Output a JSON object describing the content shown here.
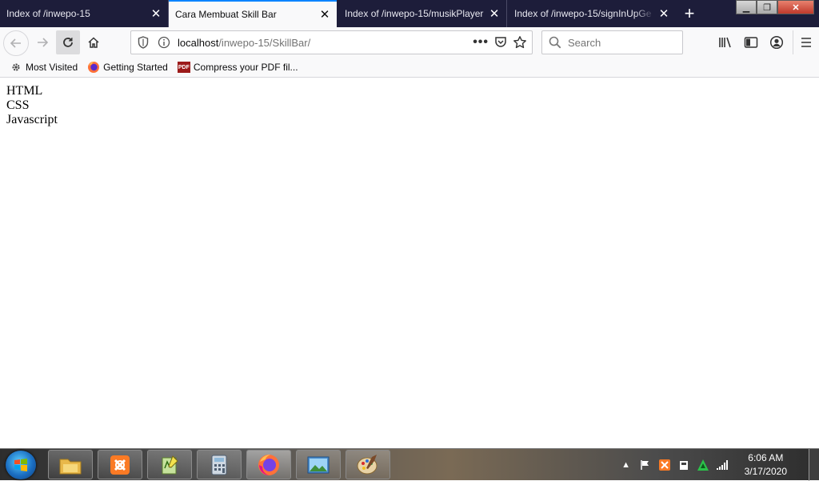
{
  "tabs": [
    {
      "label": "Index of /inwepo-15",
      "active": false
    },
    {
      "label": "Cara Membuat Skill Bar",
      "active": true
    },
    {
      "label": "Index of /inwepo-15/musikPlayer",
      "active": false
    },
    {
      "label": "Index of /inwepo-15/signInUpGe",
      "active": false
    }
  ],
  "navbar": {
    "url_host": "localhost",
    "url_path": "/inwepo-15/SkillBar/",
    "search_placeholder": "Search"
  },
  "bookmarks": [
    {
      "label": "Most Visited",
      "icon": "gear-icon"
    },
    {
      "label": "Getting Started",
      "icon": "firefox-icon"
    },
    {
      "label": "Compress your PDF fil...",
      "icon": "pdf-icon",
      "icon_text": "PDF"
    }
  ],
  "content": {
    "skills": [
      "HTML",
      "CSS",
      "Javascript"
    ]
  },
  "taskbar": {
    "apps": [
      "file-explorer",
      "xampp",
      "notepad-plus-plus",
      "calculator",
      "firefox",
      "photo-viewer",
      "paint"
    ],
    "active_app": "firefox",
    "time": "6:06 AM",
    "date": "3/17/2020"
  },
  "colors": {
    "tabstrip_bg": "#1d1d3a",
    "active_tab_accent": "#0a84ff",
    "toolbar_bg": "#f9f9fa"
  }
}
